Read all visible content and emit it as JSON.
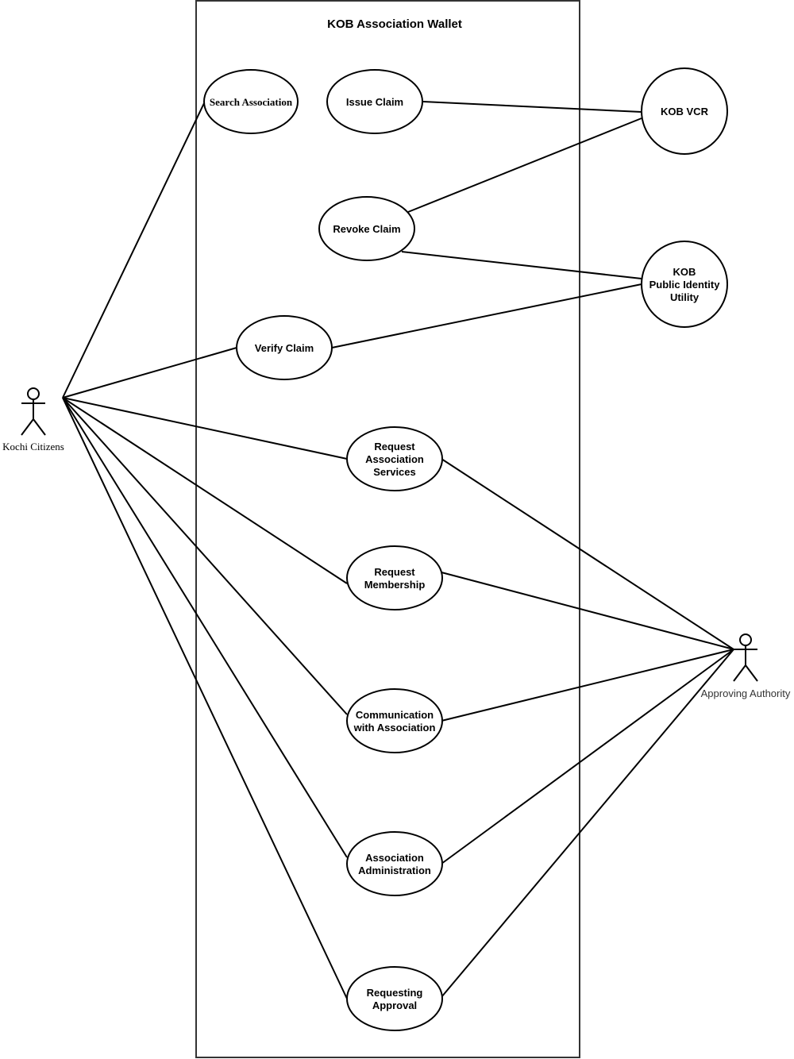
{
  "system": {
    "title": "KOB Association Wallet"
  },
  "actors": {
    "citizens": {
      "label": "Kochi Citizens"
    },
    "authority": {
      "label": "Approving Authority"
    }
  },
  "use_cases": {
    "search_association": {
      "lines": [
        "Search Association"
      ]
    },
    "issue_claim": {
      "lines": [
        "Issue Claim"
      ]
    },
    "revoke_claim": {
      "lines": [
        "Revoke Claim"
      ]
    },
    "verify_claim": {
      "lines": [
        "Verify Claim"
      ]
    },
    "request_association_services": {
      "lines": [
        "Request",
        "Association",
        "Services"
      ]
    },
    "request_membership": {
      "lines": [
        "Request",
        "Membership"
      ]
    },
    "communication_with_association": {
      "lines": [
        "Communication",
        "with Association"
      ]
    },
    "association_administration": {
      "lines": [
        "Association",
        "Administration"
      ]
    },
    "requesting_approval": {
      "lines": [
        "Requesting",
        "Approval"
      ]
    }
  },
  "external_systems": {
    "kob_vcr": {
      "lines": [
        "KOB VCR"
      ]
    },
    "kob_public_identity_utility": {
      "lines": [
        "KOB",
        "Public Identity",
        "Utility"
      ]
    }
  },
  "associations": [
    {
      "from": "Kochi Citizens",
      "to": "Search Association"
    },
    {
      "from": "Kochi Citizens",
      "to": "Verify Claim"
    },
    {
      "from": "Kochi Citizens",
      "to": "Request Association Services"
    },
    {
      "from": "Kochi Citizens",
      "to": "Request Membership"
    },
    {
      "from": "Kochi Citizens",
      "to": "Communication with Association"
    },
    {
      "from": "Kochi Citizens",
      "to": "Association Administration"
    },
    {
      "from": "Kochi Citizens",
      "to": "Requesting Approval"
    },
    {
      "from": "Issue Claim",
      "to": "KOB VCR"
    },
    {
      "from": "Revoke Claim",
      "to": "KOB VCR"
    },
    {
      "from": "Revoke Claim",
      "to": "KOB Public Identity Utility"
    },
    {
      "from": "Verify Claim",
      "to": "KOB Public Identity Utility"
    },
    {
      "from": "Request Association Services",
      "to": "Approving Authority"
    },
    {
      "from": "Request Membership",
      "to": "Approving Authority"
    },
    {
      "from": "Communication with Association",
      "to": "Approving Authority"
    },
    {
      "from": "Association Administration",
      "to": "Approving Authority"
    },
    {
      "from": "Requesting Approval",
      "to": "Approving Authority"
    }
  ]
}
